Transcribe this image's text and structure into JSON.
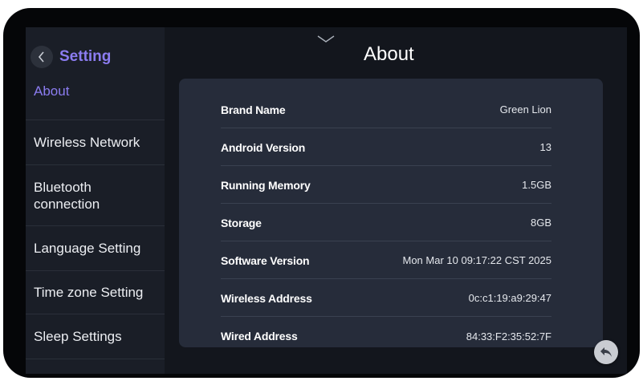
{
  "sidebar": {
    "title": "Setting",
    "items": [
      {
        "label": "About"
      },
      {
        "label": "Wireless Network"
      },
      {
        "label": "Bluetooth connection"
      },
      {
        "label": "Language Setting"
      },
      {
        "label": "Time zone Setting"
      },
      {
        "label": "Sleep Settings"
      }
    ]
  },
  "main": {
    "title": "About",
    "rows": [
      {
        "label": "Brand Name",
        "value": "Green Lion"
      },
      {
        "label": "Android Version",
        "value": "13"
      },
      {
        "label": "Running Memory",
        "value": "1.5GB"
      },
      {
        "label": "Storage",
        "value": "8GB"
      },
      {
        "label": "Software Version",
        "value": "Mon Mar 10 09:17:22 CST 2025"
      },
      {
        "label": "Wireless Address",
        "value": "0c:c1:19:a9:29:47"
      },
      {
        "label": "Wired Address",
        "value": "84:33:F2:35:52:7F"
      }
    ]
  },
  "colors": {
    "accent": "#8b7cf0",
    "background": "#13161d",
    "sidebar": "#1a1e27",
    "panel": "#262c3a"
  },
  "icons": {
    "back": "chevron-left-icon",
    "collapse": "chevron-down-icon",
    "return": "return-arrow-icon"
  }
}
